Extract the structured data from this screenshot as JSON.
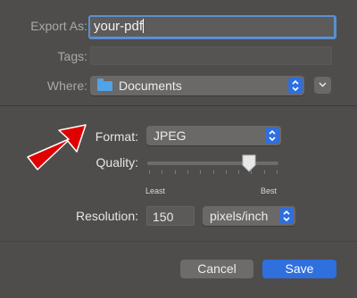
{
  "export": {
    "label": "Export As:",
    "value": "your-pdf"
  },
  "tags": {
    "label": "Tags:",
    "value": ""
  },
  "where": {
    "label": "Where:",
    "value": "Documents",
    "icon": "folder-icon"
  },
  "format": {
    "label": "Format:",
    "value": "JPEG"
  },
  "quality": {
    "label": "Quality:",
    "min_label": "Least",
    "max_label": "Best",
    "level": 0.78
  },
  "resolution": {
    "label": "Resolution:",
    "value": "150",
    "unit": "pixels/inch"
  },
  "actions": {
    "cancel_label": "Cancel",
    "save_label": "Save"
  },
  "colors": {
    "accent": "#2f6fde",
    "focus": "#5b8fd0",
    "arrow": "#e00000",
    "background": "#4e4d4c"
  }
}
